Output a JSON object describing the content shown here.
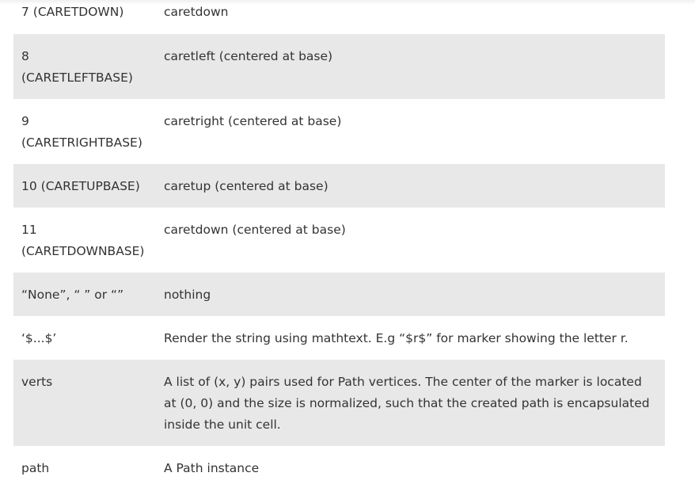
{
  "rows": [
    {
      "key": "7 (CARETDOWN)",
      "desc": "caretdown"
    },
    {
      "key": "8\n(CARETLEFTBASE)",
      "desc": "caretleft (centered at base)"
    },
    {
      "key": "9\n(CARETRIGHTBASE)",
      "desc": "caretright (centered at base)"
    },
    {
      "key": "10 (CARETUPBASE)",
      "desc": "caretup (centered at base)"
    },
    {
      "key": "11\n(CARETDOWNBASE)",
      "desc": "caretdown (centered at base)"
    },
    {
      "key": "“None”, “ ” or “”",
      "desc": "nothing"
    },
    {
      "key": "‘$...$’",
      "desc": "Render the string using mathtext. E.g “$r$” for marker showing the letter r."
    },
    {
      "key": "verts",
      "desc": "A list of (x, y) pairs used for Path vertices. The center of the marker is located at (0, 0) and the size is normalized, such that the created path is encapsulated inside the unit cell."
    },
    {
      "key": "path",
      "desc": "A Path instance"
    }
  ]
}
